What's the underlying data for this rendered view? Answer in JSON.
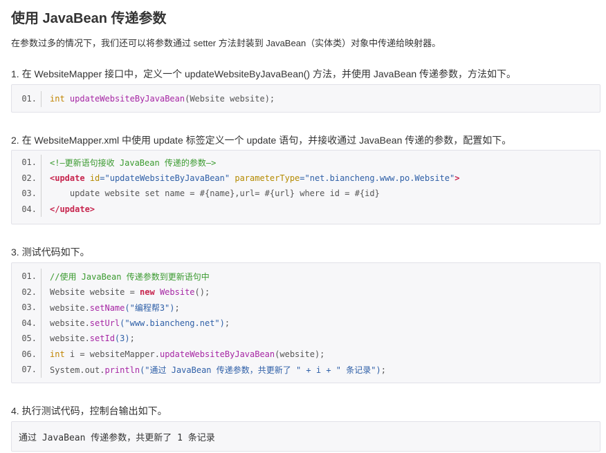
{
  "title": "使用 JavaBean 传递参数",
  "intro": "在参数过多的情况下，我们还可以将参数通过 setter 方法封装到 JavaBean（实体类）对象中传递给映射器。",
  "steps": [
    "1. 在 WebsiteMapper 接口中，定义一个 updateWebsiteByJavaBean() 方法，并使用 JavaBean 传递参数，方法如下。",
    "2. 在 WebsiteMapper.xml 中使用 update 标签定义一个 update 语句，并接收通过 JavaBean 传递的参数，配置如下。",
    "3. 测试代码如下。",
    "4. 执行测试代码，控制台输出如下。"
  ],
  "code1": {
    "line_numbers": [
      "01."
    ],
    "l1_kw": "int",
    "l1_fn": "updateWebsiteByJavaBean",
    "l1_rest": "(Website website);"
  },
  "code2": {
    "line_numbers": [
      "01.",
      "02.",
      "03.",
      "04."
    ],
    "l1": "<!—更新语句接收 JavaBean 传递的参数—>",
    "l2_tag_open": "<update",
    "l2_attr1": "id",
    "l2_val1": "=\"updateWebsiteByJavaBean\"",
    "l2_attr2": "parameterType",
    "l2_val2": "=\"net.biancheng.www.po.Website\"",
    "l2_close": ">",
    "l3": "    update website set name = #{name},url= #{url} where id = #{id}",
    "l4": "</update>"
  },
  "code3": {
    "line_numbers": [
      "01.",
      "02.",
      "03.",
      "04.",
      "05.",
      "06.",
      "07."
    ],
    "l1": "//使用 JavaBean 传递参数到更新语句中",
    "l2_a": "Website website = ",
    "l2_new": "new",
    "l2_cls": " Website",
    "l2_b": "();",
    "l3_a": "website.",
    "l3_fn": "setName",
    "l3_str": "(\"编程帮3\")",
    "l3_b": ";",
    "l4_a": "website.",
    "l4_fn": "setUrl",
    "l4_str": "(\"www.biancheng.net\")",
    "l4_b": ";",
    "l5_a": "website.",
    "l5_fn": "setId",
    "l5_str": "(3)",
    "l5_b": ";",
    "l6_kw": "int",
    "l6_a": " i = websiteMapper.",
    "l6_fn": "updateWebsiteByJavaBean",
    "l6_b": "(website);",
    "l7_a": "System.out.",
    "l7_fn": "println",
    "l7_str": "(\"通过 JavaBean 传递参数，共更新了 \" + i + \" 条记录\")",
    "l7_b": ";"
  },
  "output": "通过 JavaBean 传递参数，共更新了 1 条记录",
  "colors": {
    "keyword": "#c18401",
    "function": "#a626a4",
    "string": "#2e5fa7",
    "comment": "#3a9a2f",
    "tag": "#c7254e",
    "code_bg": "#f7f7f9"
  }
}
